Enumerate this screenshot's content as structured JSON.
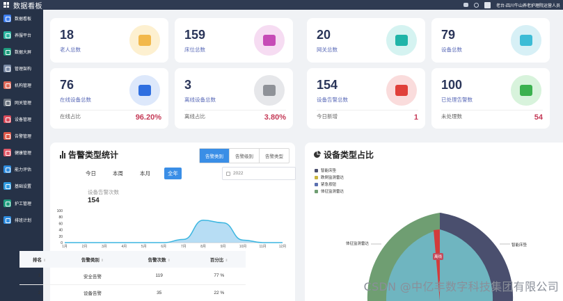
{
  "app": {
    "title": "数据看板",
    "user_text": "老台-四川牛山养老护理院运营人员"
  },
  "sidebar": {
    "items": [
      {
        "label": "数据看板",
        "color": "#3d7ef0"
      },
      {
        "label": "养服平台",
        "color": "#2db7a3"
      },
      {
        "label": "数据大屏",
        "color": "#1f9c7e"
      },
      {
        "label": "管理架构",
        "color": "#7a8aa6"
      },
      {
        "label": "机构管理",
        "color": "#e06a5a"
      },
      {
        "label": "网关管理",
        "color": "#6b7480"
      },
      {
        "label": "设备管理",
        "color": "#d94a5a"
      },
      {
        "label": "告警管理",
        "color": "#e05a4a"
      },
      {
        "label": "健康管理",
        "color": "#e05a6a"
      },
      {
        "label": "能力评估",
        "color": "#2f8de0"
      },
      {
        "label": "基础设置",
        "color": "#2f9be0"
      },
      {
        "label": "护工管理",
        "color": "#1f9c7e"
      },
      {
        "label": "排班计划",
        "color": "#2f8de0"
      }
    ]
  },
  "stats_row1": [
    {
      "value": "18",
      "label": "老人总数",
      "bg": "#fdf0d0",
      "fg": "#f2b84b",
      "icon": "house-icon"
    },
    {
      "value": "159",
      "label": "床位总数",
      "bg": "#f6dcf2",
      "fg": "#c64bb6",
      "icon": "bed-icon"
    },
    {
      "value": "20",
      "label": "网关总数",
      "bg": "#d5f3f1",
      "fg": "#1fb4a8",
      "icon": "router-icon"
    },
    {
      "value": "79",
      "label": "设备总数",
      "bg": "#d7f0f6",
      "fg": "#3cbcd6",
      "icon": "device-icon"
    }
  ],
  "stats_row2": [
    {
      "value": "76",
      "label": "在线设备总数",
      "bg": "#dde8fb",
      "fg": "#2f6fe0",
      "icon": "monitor-icon",
      "foot_label": "在线占比",
      "foot_value": "96.20%"
    },
    {
      "value": "3",
      "label": "离线设备总数",
      "bg": "#e6e7ea",
      "fg": "#8f9298",
      "icon": "offline-icon",
      "foot_label": "离线占比",
      "foot_value": "3.80%"
    },
    {
      "value": "154",
      "label": "设备告警总数",
      "bg": "#fadcdc",
      "fg": "#e0403a",
      "icon": "alarm-icon",
      "foot_label": "今日新增",
      "foot_value": "1"
    },
    {
      "value": "100",
      "label": "已处理告警数",
      "bg": "#d8f3dc",
      "fg": "#3bb14f",
      "icon": "check-icon",
      "foot_label": "未处理数",
      "foot_value": "54"
    }
  ],
  "alarm_panel": {
    "title": "告警类型统计",
    "tabs": [
      "告警类别",
      "告警级别",
      "告警类型"
    ],
    "ranges": [
      "今日",
      "本周",
      "本月",
      "全年"
    ],
    "date_value": "2022",
    "metric_label": "设备告警次数",
    "metric_value": "154",
    "table": {
      "headers": [
        "排名",
        "告警类别",
        "告警次数",
        "百分比"
      ],
      "rows": [
        [
          "1",
          "安全告警",
          "119",
          "77 %"
        ],
        [
          "2",
          "设备告警",
          "35",
          "22 %"
        ]
      ]
    }
  },
  "chart_data": {
    "type": "area",
    "x": [
      "1月",
      "2月",
      "3月",
      "4月",
      "5月",
      "6月",
      "7月",
      "8月",
      "9月",
      "10月",
      "11月",
      "12月"
    ],
    "series": [
      {
        "values": [
          0,
          0,
          0,
          0,
          0,
          0,
          10,
          70,
          62,
          8,
          0,
          0
        ]
      }
    ],
    "yticks": [
      "100",
      "80",
      "60",
      "40",
      "20",
      "0"
    ],
    "ylim": [
      0,
      100
    ],
    "color": "#3cb6e0"
  },
  "device_panel": {
    "title": "设备类型占比",
    "legend": [
      {
        "label": "智能床垫",
        "color": "#4a4f6e"
      },
      {
        "label": "跌倒监测雷达",
        "color": "#c9b53f"
      },
      {
        "label": "紧急按钮",
        "color": "#5a6fb0"
      },
      {
        "label": "体征监测雷达",
        "color": "#6f9e72"
      }
    ],
    "outer_labels": [
      "体征监测雷达",
      "智能床垫"
    ],
    "inner_label": "离线"
  },
  "watermark": "CSDN @中亿丰数字科技集团有限公司"
}
